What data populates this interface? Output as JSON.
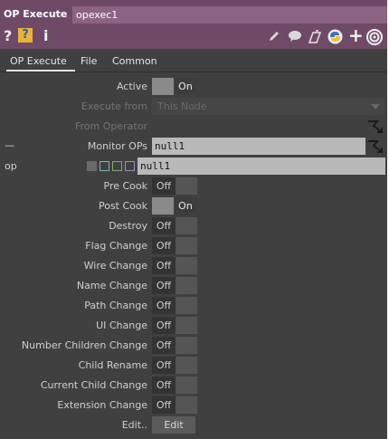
{
  "header": {
    "op_type": "OP Execute",
    "op_name": "opexec1",
    "icons": [
      "help-icon",
      "python-help-icon",
      "info-icon",
      "pencil-icon",
      "comment-icon",
      "clone-icon",
      "python-icon",
      "plus-icon",
      "target-icon"
    ],
    "q": "?",
    "i": "i",
    "plus": "+"
  },
  "tabs": [
    "OP Execute",
    "File",
    "Common"
  ],
  "params": {
    "active": {
      "label": "Active",
      "value": "On"
    },
    "execute_from": {
      "label": "Execute from",
      "value": "This Node"
    },
    "from_operator": {
      "label": "From Operator"
    },
    "monitor_ops": {
      "label": "Monitor OPs",
      "value": "null1",
      "left_mark": "—"
    },
    "op_row": {
      "label": "op",
      "value": "null1"
    },
    "pre_cook": {
      "label": "Pre Cook",
      "value": "Off"
    },
    "post_cook": {
      "label": "Post Cook",
      "value": "On"
    },
    "destroy": {
      "label": "Destroy",
      "value": "Off"
    },
    "flag_change": {
      "label": "Flag Change",
      "value": "Off"
    },
    "wire_change": {
      "label": "Wire Change",
      "value": "Off"
    },
    "name_change": {
      "label": "Name Change",
      "value": "Off"
    },
    "path_change": {
      "label": "Path Change",
      "value": "Off"
    },
    "ui_change": {
      "label": "UI Change",
      "value": "Off"
    },
    "number_children_change": {
      "label": "Number Children Change",
      "value": "Off"
    },
    "child_rename": {
      "label": "Child Rename",
      "value": "Off"
    },
    "current_child_change": {
      "label": "Current Child Change",
      "value": "Off"
    },
    "extension_change": {
      "label": "Extension Change",
      "value": "Off"
    },
    "edit": {
      "label": "Edit..",
      "value": "Edit"
    }
  },
  "colors": {
    "header_bg": "#6f4a66",
    "panel_bg": "#404040",
    "field_bg": "#b9b9b9"
  }
}
